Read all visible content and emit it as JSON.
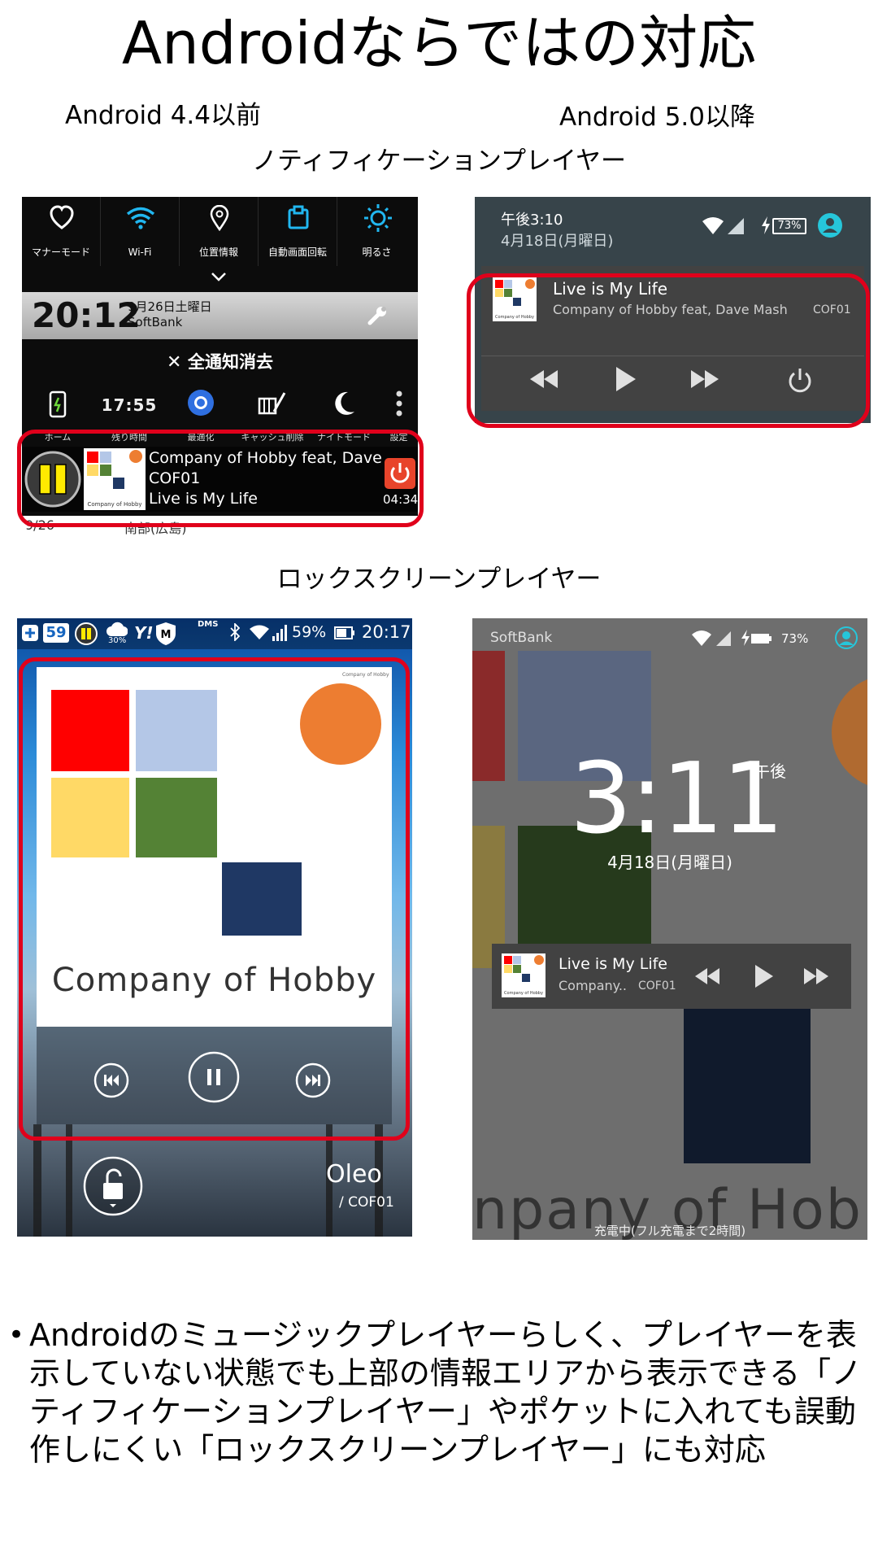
{
  "slide": {
    "title": "Androidならではの対応",
    "label_old": "Android 4.4以前",
    "label_new": "Android 5.0以降",
    "section_notification": "ノティフィケーションプレイヤー",
    "section_lockscreen": "ロックスクリーンプレイヤー",
    "bullet_mark": "•",
    "bullet_text": "Androidのミュージックプレイヤーらしく、プレイヤーを表示していない状態でも上部の情報エリアから表示できる「ノティフィケーションプレイヤー」やポケットに入れても誤動作しにくい「ロックスクリーンプレイヤー」にも対応"
  },
  "old_notification": {
    "quick_settings": [
      {
        "label": "マナーモード",
        "icon": "heart-icon"
      },
      {
        "label": "Wi-Fi",
        "icon": "wifi-icon"
      },
      {
        "label": "位置情報",
        "icon": "location-pin-icon"
      },
      {
        "label": "自動画面回転",
        "icon": "rotate-icon"
      },
      {
        "label": "明るさ",
        "icon": "brightness-icon"
      }
    ],
    "time": "20:12",
    "date": "9月26日土曜日",
    "carrier": "SoftBank",
    "clear_all": "全通知消去",
    "tools": [
      {
        "label": "ホーム",
        "icon": "phone-battery-icon"
      },
      {
        "label": "残り時間",
        "icon": "clock-icon",
        "value": "17:55"
      },
      {
        "label": "最適化",
        "icon": "optimize-icon"
      },
      {
        "label": "キャッシュ削除",
        "icon": "broom-icon"
      },
      {
        "label": "ナイトモード",
        "icon": "moon-icon"
      },
      {
        "label": "設定",
        "icon": "more-vert-icon"
      }
    ],
    "player": {
      "artist_line": "Company of Hobby feat, Dave Ma",
      "album": "COF01",
      "song": "Live is My Life",
      "elapsed": "04:34",
      "art_caption": "Company of Hobby"
    },
    "bottom_row": {
      "date": "9/26",
      "text": "南部(広島)"
    }
  },
  "new_notification": {
    "time": "午後3:10",
    "date": "4月18日(月曜日)",
    "battery": "73%",
    "song": "Live is My Life",
    "artist": "Company of Hobby feat, Dave Mash",
    "album": "COF01",
    "art_caption": "Company of Hobby"
  },
  "old_lockscreen": {
    "status": {
      "notif_count": "59",
      "weather": "30%",
      "carrier_tag": "DMS",
      "battery": "59%",
      "time": "20:17"
    },
    "art_caption": "Company of Hobby",
    "art_small": "Company of Hobby",
    "song": "Oleo",
    "album": "/ COF01"
  },
  "new_lockscreen": {
    "carrier": "SoftBank",
    "battery": "73%",
    "time": "3:11",
    "ampm": "午後",
    "date": "4月18日(月曜日)",
    "song": "Live is My Life",
    "artist": "Company..",
    "album": "COF01",
    "bg_text": "npany of Hob",
    "charging": "充電中(フル充電まで2時間)",
    "art_caption": "Company of Hobby"
  },
  "colors": {
    "highlight": "#e0001b",
    "art_red": "#ff0000",
    "art_lightblue": "#b4c7e7",
    "art_yellow": "#ffd966",
    "art_green": "#548235",
    "art_navy": "#1f3864",
    "art_orange": "#ed7d31",
    "teal_accent": "#26c6da"
  }
}
